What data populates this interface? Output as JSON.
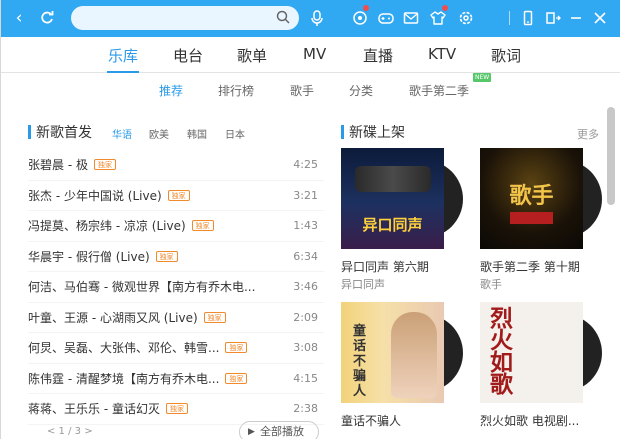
{
  "titlebar": {
    "search_placeholder": ""
  },
  "main_tabs": [
    "乐库",
    "电台",
    "歌单",
    "MV",
    "直播",
    "KTV",
    "歌词"
  ],
  "sub_tabs": [
    "推荐",
    "排行榜",
    "歌手",
    "分类",
    "歌手第二季"
  ],
  "new_badge": "NEW",
  "left": {
    "title": "新歌首发",
    "filters": [
      "华语",
      "欧美",
      "韩国",
      "日本"
    ],
    "songs": [
      {
        "title": "张碧晨 - 极",
        "tag": "独家",
        "duration": "4:25"
      },
      {
        "title": "张杰 - 少年中国说 (Live)",
        "tag": "独家",
        "duration": "3:21"
      },
      {
        "title": "冯提莫、杨宗纬 - 凉凉 (Live)",
        "tag": "独家",
        "duration": "1:43"
      },
      {
        "title": "华晨宇 - 假行僧 (Live)",
        "tag": "独家",
        "duration": "6:34"
      },
      {
        "title": "何洁、马伯骞 - 微观世界【南方有乔木电...",
        "tag": "",
        "duration": "3:46"
      },
      {
        "title": "叶童、王源 - 心湖雨又风 (Live)",
        "tag": "独家",
        "duration": "2:09"
      },
      {
        "title": "何炅、吴磊、大张伟、邓伦、韩雪...",
        "tag": "独家",
        "duration": "3:08"
      },
      {
        "title": "陈伟霆 - 清醒梦境【南方有乔木电...",
        "tag": "独家",
        "duration": "4:15"
      },
      {
        "title": "蒋蒋、王乐乐 - 童话幻灭",
        "tag": "独家",
        "duration": "2:38"
      }
    ],
    "pager": "< 1 / 3 >",
    "play_all": "全部播放"
  },
  "right": {
    "title": "新碟上架",
    "more": "更多",
    "albums": [
      {
        "name": "异口同声 第六期",
        "artist": "异口同声",
        "cover_text": "异口同声"
      },
      {
        "name": "歌手第二季 第十期",
        "artist": "歌手",
        "cover_text": "歌手"
      },
      {
        "name": "童话不骗人",
        "artist": "",
        "cover_text": "童话不骗人"
      },
      {
        "name": "烈火如歌 电视剧...",
        "artist": "",
        "cover_text": "烈火如歌"
      }
    ]
  }
}
